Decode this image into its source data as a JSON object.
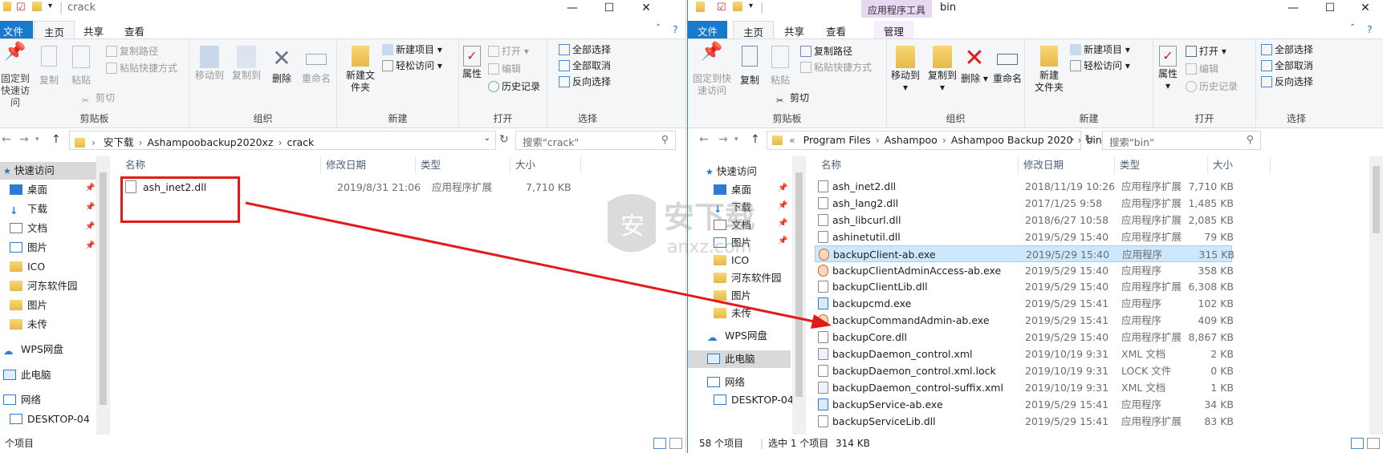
{
  "left": {
    "title": "crack",
    "tabs": {
      "file": "文件",
      "home": "主页",
      "share": "共享",
      "view": "查看"
    },
    "ribbon": {
      "clipboard": {
        "label": "剪贴板",
        "pin": "固定到快速访问",
        "copy": "复制",
        "paste": "粘贴",
        "copy_path": "复制路径",
        "paste_shortcut": "粘贴快捷方式",
        "cut": "剪切"
      },
      "organize": {
        "label": "组织",
        "move_to": "移动到",
        "copy_to": "复制到",
        "delete": "删除",
        "rename": "重命名"
      },
      "new": {
        "label": "新建",
        "new_folder": "新建文件夹",
        "new_item": "新建项目",
        "easy_access": "轻松访问"
      },
      "open": {
        "label": "打开",
        "properties": "属性",
        "open": "打开",
        "edit": "编辑",
        "history": "历史记录"
      },
      "select": {
        "label": "选择",
        "select_all": "全部选择",
        "select_none": "全部取消",
        "invert": "反向选择"
      }
    },
    "path": [
      "安下载",
      "Ashampoobackup2020xz",
      "crack"
    ],
    "search_placeholder": "搜索\"crack\"",
    "nav": [
      "快速访问",
      "桌面",
      "下载",
      "文档",
      "图片",
      "ICO",
      "河东软件园",
      "图片",
      "未传",
      "WPS网盘",
      "此电脑",
      "网络",
      "DESKTOP-04"
    ],
    "columns": {
      "name": "名称",
      "date": "修改日期",
      "type": "类型",
      "size": "大小"
    },
    "files": [
      {
        "name": "ash_inet2.dll",
        "date": "2019/8/31 21:06",
        "type": "应用程序扩展",
        "size": "7,710 KB"
      }
    ],
    "status": "个项目"
  },
  "right": {
    "title": "bin",
    "context_tab": "应用程序工具",
    "tabs": {
      "file": "文件",
      "home": "主页",
      "share": "共享",
      "view": "查看",
      "manage": "管理"
    },
    "ribbon": {
      "clipboard": {
        "label": "剪贴板",
        "pin_l1": "固定到快",
        "pin_l2": "速访问",
        "copy": "复制",
        "paste": "粘贴",
        "copy_path": "复制路径",
        "paste_shortcut": "粘贴快捷方式",
        "cut": "剪切"
      },
      "organize": {
        "label": "组织",
        "move_to": "移动到",
        "copy_to": "复制到",
        "delete": "删除",
        "rename": "重命名"
      },
      "new": {
        "label": "新建",
        "new_folder_l1": "新建",
        "new_folder_l2": "文件夹",
        "new_item": "新建项目",
        "easy_access": "轻松访问"
      },
      "open": {
        "label": "打开",
        "properties": "属性",
        "open": "打开",
        "edit": "编辑",
        "history": "历史记录"
      },
      "select": {
        "label": "选择",
        "select_all": "全部选择",
        "select_none": "全部取消",
        "invert": "反向选择"
      }
    },
    "path": [
      "Program Files",
      "Ashampoo",
      "Ashampoo Backup 2020",
      "bin"
    ],
    "search_placeholder": "搜索\"bin\"",
    "nav": [
      "快速访问",
      "桌面",
      "下载",
      "文档",
      "图片",
      "ICO",
      "河东软件园",
      "图片",
      "未传",
      "WPS网盘",
      "此电脑",
      "网络",
      "DESKTOP-04"
    ],
    "columns": {
      "name": "名称",
      "date": "修改日期",
      "type": "类型",
      "size": "大小"
    },
    "files": [
      {
        "name": "ash_inet2.dll",
        "date": "2018/11/19 10:26",
        "type": "应用程序扩展",
        "size": "7,710 KB",
        "icon": "dll"
      },
      {
        "name": "ash_lang2.dll",
        "date": "2017/1/25 9:58",
        "type": "应用程序扩展",
        "size": "1,485 KB",
        "icon": "dll"
      },
      {
        "name": "ash_libcurl.dll",
        "date": "2018/6/27 10:58",
        "type": "应用程序扩展",
        "size": "2,085 KB",
        "icon": "dll"
      },
      {
        "name": "ashinetutil.dll",
        "date": "2019/5/29 15:40",
        "type": "应用程序扩展",
        "size": "79 KB",
        "icon": "dll"
      },
      {
        "name": "backupClient-ab.exe",
        "date": "2019/5/29 15:40",
        "type": "应用程序",
        "size": "315 KB",
        "icon": "exe-orange",
        "selected": true
      },
      {
        "name": "backupClientAdminAccess-ab.exe",
        "date": "2019/5/29 15:40",
        "type": "应用程序",
        "size": "358 KB",
        "icon": "exe-orange"
      },
      {
        "name": "backupClientLib.dll",
        "date": "2019/5/29 15:40",
        "type": "应用程序扩展",
        "size": "6,308 KB",
        "icon": "dll"
      },
      {
        "name": "backupcmd.exe",
        "date": "2019/5/29 15:41",
        "type": "应用程序",
        "size": "102 KB",
        "icon": "exe-blue"
      },
      {
        "name": "backupCommandAdmin-ab.exe",
        "date": "2019/5/29 15:41",
        "type": "应用程序",
        "size": "409 KB",
        "icon": "exe-orange"
      },
      {
        "name": "backupCore.dll",
        "date": "2019/5/29 15:40",
        "type": "应用程序扩展",
        "size": "8,867 KB",
        "icon": "dll"
      },
      {
        "name": "backupDaemon_control.xml",
        "date": "2019/10/19 9:31",
        "type": "XML 文档",
        "size": "2 KB",
        "icon": "xml"
      },
      {
        "name": "backupDaemon_control.xml.lock",
        "date": "2019/10/19 9:31",
        "type": "LOCK 文件",
        "size": "0 KB",
        "icon": "file"
      },
      {
        "name": "backupDaemon_control-suffix.xml",
        "date": "2019/10/19 9:31",
        "type": "XML 文档",
        "size": "1 KB",
        "icon": "xml"
      },
      {
        "name": "backupService-ab.exe",
        "date": "2019/5/29 15:41",
        "type": "应用程序",
        "size": "34 KB",
        "icon": "exe-blue"
      },
      {
        "name": "backupServiceLib.dll",
        "date": "2019/5/29 15:41",
        "type": "应用程序扩展",
        "size": "83 KB",
        "icon": "dll"
      }
    ],
    "status_count": "58 个项目",
    "status_sel": "选中 1 个项目",
    "status_size": "314 KB"
  },
  "watermark": {
    "text": "安下载",
    "sub": "anxz.com"
  },
  "colors": {
    "accent": "#1979ca",
    "highlight_box": "#e11a1a",
    "arrow": "#e11a1a",
    "selection": "#cce8ff",
    "context_tab": "#e8d7f1"
  }
}
